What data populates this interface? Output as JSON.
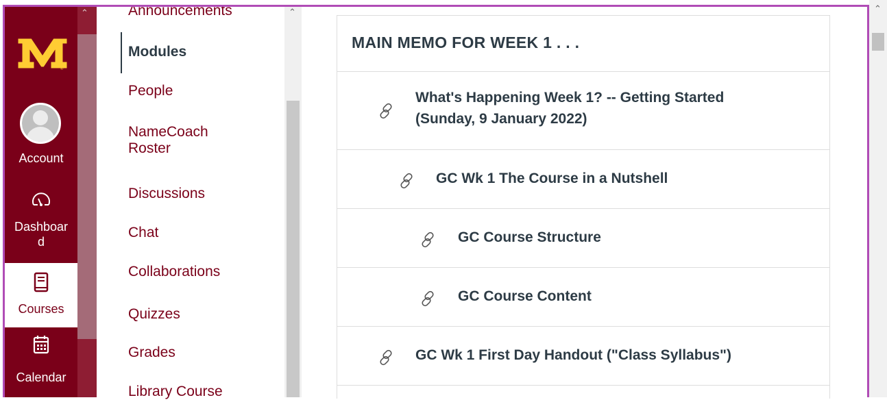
{
  "global_nav": {
    "logo": "M",
    "items": [
      {
        "label": "Account",
        "icon": "account-avatar-icon"
      },
      {
        "label": "Dashboard",
        "icon": "speedometer-icon"
      },
      {
        "label": "Courses",
        "icon": "book-icon",
        "active": true
      },
      {
        "label": "Calendar",
        "icon": "calendar-icon"
      }
    ],
    "dashboard_line1": "Dashboar",
    "dashboard_line2": "d"
  },
  "course_nav": {
    "items": [
      {
        "label": "Announcements"
      },
      {
        "label": "Modules",
        "active": true
      },
      {
        "label": "People"
      },
      {
        "label": "NameCoach",
        "label2": "Roster"
      },
      {
        "label": "Discussions"
      },
      {
        "label": "Chat"
      },
      {
        "label": "Collaborations"
      },
      {
        "label": "Quizzes"
      },
      {
        "label": "Grades"
      },
      {
        "label": "Library Course"
      }
    ]
  },
  "module": {
    "header": "MAIN MEMO FOR WEEK 1 . . .",
    "items": [
      {
        "line1": "What's Happening Week 1? -- Getting Started",
        "line2": "(Sunday, 9 January 2022)",
        "icon": "link-icon"
      },
      {
        "line1": "GC Wk 1 The Course in a Nutshell",
        "icon": "link-icon"
      },
      {
        "line1": "GC Course Structure",
        "icon": "link-icon"
      },
      {
        "line1": "GC Course Content",
        "icon": "link-icon"
      },
      {
        "line1": "GC Wk 1 First Day Handout (\"Class Syllabus\")",
        "icon": "link-icon"
      }
    ]
  },
  "colors": {
    "brand": "#7a0019",
    "gold": "#ffcc33",
    "highlight_border": "#b04cb6"
  }
}
